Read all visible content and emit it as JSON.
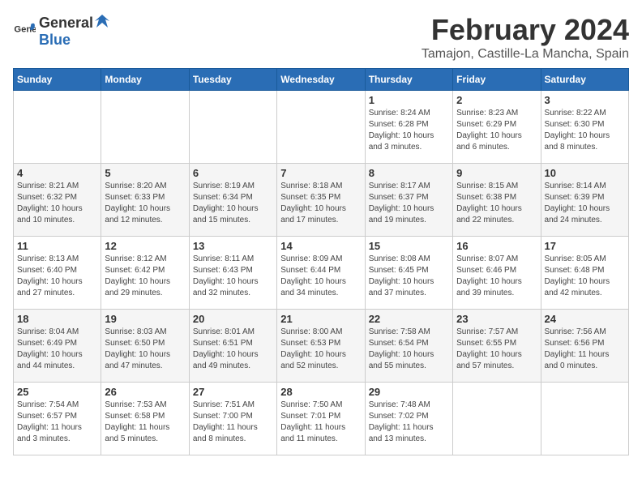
{
  "logo": {
    "text_general": "General",
    "text_blue": "Blue"
  },
  "header": {
    "month_title": "February 2024",
    "location": "Tamajon, Castille-La Mancha, Spain"
  },
  "weekdays": [
    "Sunday",
    "Monday",
    "Tuesday",
    "Wednesday",
    "Thursday",
    "Friday",
    "Saturday"
  ],
  "weeks": [
    [
      {
        "day": "",
        "info": ""
      },
      {
        "day": "",
        "info": ""
      },
      {
        "day": "",
        "info": ""
      },
      {
        "day": "",
        "info": ""
      },
      {
        "day": "1",
        "info": "Sunrise: 8:24 AM\nSunset: 6:28 PM\nDaylight: 10 hours\nand 3 minutes."
      },
      {
        "day": "2",
        "info": "Sunrise: 8:23 AM\nSunset: 6:29 PM\nDaylight: 10 hours\nand 6 minutes."
      },
      {
        "day": "3",
        "info": "Sunrise: 8:22 AM\nSunset: 6:30 PM\nDaylight: 10 hours\nand 8 minutes."
      }
    ],
    [
      {
        "day": "4",
        "info": "Sunrise: 8:21 AM\nSunset: 6:32 PM\nDaylight: 10 hours\nand 10 minutes."
      },
      {
        "day": "5",
        "info": "Sunrise: 8:20 AM\nSunset: 6:33 PM\nDaylight: 10 hours\nand 12 minutes."
      },
      {
        "day": "6",
        "info": "Sunrise: 8:19 AM\nSunset: 6:34 PM\nDaylight: 10 hours\nand 15 minutes."
      },
      {
        "day": "7",
        "info": "Sunrise: 8:18 AM\nSunset: 6:35 PM\nDaylight: 10 hours\nand 17 minutes."
      },
      {
        "day": "8",
        "info": "Sunrise: 8:17 AM\nSunset: 6:37 PM\nDaylight: 10 hours\nand 19 minutes."
      },
      {
        "day": "9",
        "info": "Sunrise: 8:15 AM\nSunset: 6:38 PM\nDaylight: 10 hours\nand 22 minutes."
      },
      {
        "day": "10",
        "info": "Sunrise: 8:14 AM\nSunset: 6:39 PM\nDaylight: 10 hours\nand 24 minutes."
      }
    ],
    [
      {
        "day": "11",
        "info": "Sunrise: 8:13 AM\nSunset: 6:40 PM\nDaylight: 10 hours\nand 27 minutes."
      },
      {
        "day": "12",
        "info": "Sunrise: 8:12 AM\nSunset: 6:42 PM\nDaylight: 10 hours\nand 29 minutes."
      },
      {
        "day": "13",
        "info": "Sunrise: 8:11 AM\nSunset: 6:43 PM\nDaylight: 10 hours\nand 32 minutes."
      },
      {
        "day": "14",
        "info": "Sunrise: 8:09 AM\nSunset: 6:44 PM\nDaylight: 10 hours\nand 34 minutes."
      },
      {
        "day": "15",
        "info": "Sunrise: 8:08 AM\nSunset: 6:45 PM\nDaylight: 10 hours\nand 37 minutes."
      },
      {
        "day": "16",
        "info": "Sunrise: 8:07 AM\nSunset: 6:46 PM\nDaylight: 10 hours\nand 39 minutes."
      },
      {
        "day": "17",
        "info": "Sunrise: 8:05 AM\nSunset: 6:48 PM\nDaylight: 10 hours\nand 42 minutes."
      }
    ],
    [
      {
        "day": "18",
        "info": "Sunrise: 8:04 AM\nSunset: 6:49 PM\nDaylight: 10 hours\nand 44 minutes."
      },
      {
        "day": "19",
        "info": "Sunrise: 8:03 AM\nSunset: 6:50 PM\nDaylight: 10 hours\nand 47 minutes."
      },
      {
        "day": "20",
        "info": "Sunrise: 8:01 AM\nSunset: 6:51 PM\nDaylight: 10 hours\nand 49 minutes."
      },
      {
        "day": "21",
        "info": "Sunrise: 8:00 AM\nSunset: 6:53 PM\nDaylight: 10 hours\nand 52 minutes."
      },
      {
        "day": "22",
        "info": "Sunrise: 7:58 AM\nSunset: 6:54 PM\nDaylight: 10 hours\nand 55 minutes."
      },
      {
        "day": "23",
        "info": "Sunrise: 7:57 AM\nSunset: 6:55 PM\nDaylight: 10 hours\nand 57 minutes."
      },
      {
        "day": "24",
        "info": "Sunrise: 7:56 AM\nSunset: 6:56 PM\nDaylight: 11 hours\nand 0 minutes."
      }
    ],
    [
      {
        "day": "25",
        "info": "Sunrise: 7:54 AM\nSunset: 6:57 PM\nDaylight: 11 hours\nand 3 minutes."
      },
      {
        "day": "26",
        "info": "Sunrise: 7:53 AM\nSunset: 6:58 PM\nDaylight: 11 hours\nand 5 minutes."
      },
      {
        "day": "27",
        "info": "Sunrise: 7:51 AM\nSunset: 7:00 PM\nDaylight: 11 hours\nand 8 minutes."
      },
      {
        "day": "28",
        "info": "Sunrise: 7:50 AM\nSunset: 7:01 PM\nDaylight: 11 hours\nand 11 minutes."
      },
      {
        "day": "29",
        "info": "Sunrise: 7:48 AM\nSunset: 7:02 PM\nDaylight: 11 hours\nand 13 minutes."
      },
      {
        "day": "",
        "info": ""
      },
      {
        "day": "",
        "info": ""
      }
    ]
  ]
}
